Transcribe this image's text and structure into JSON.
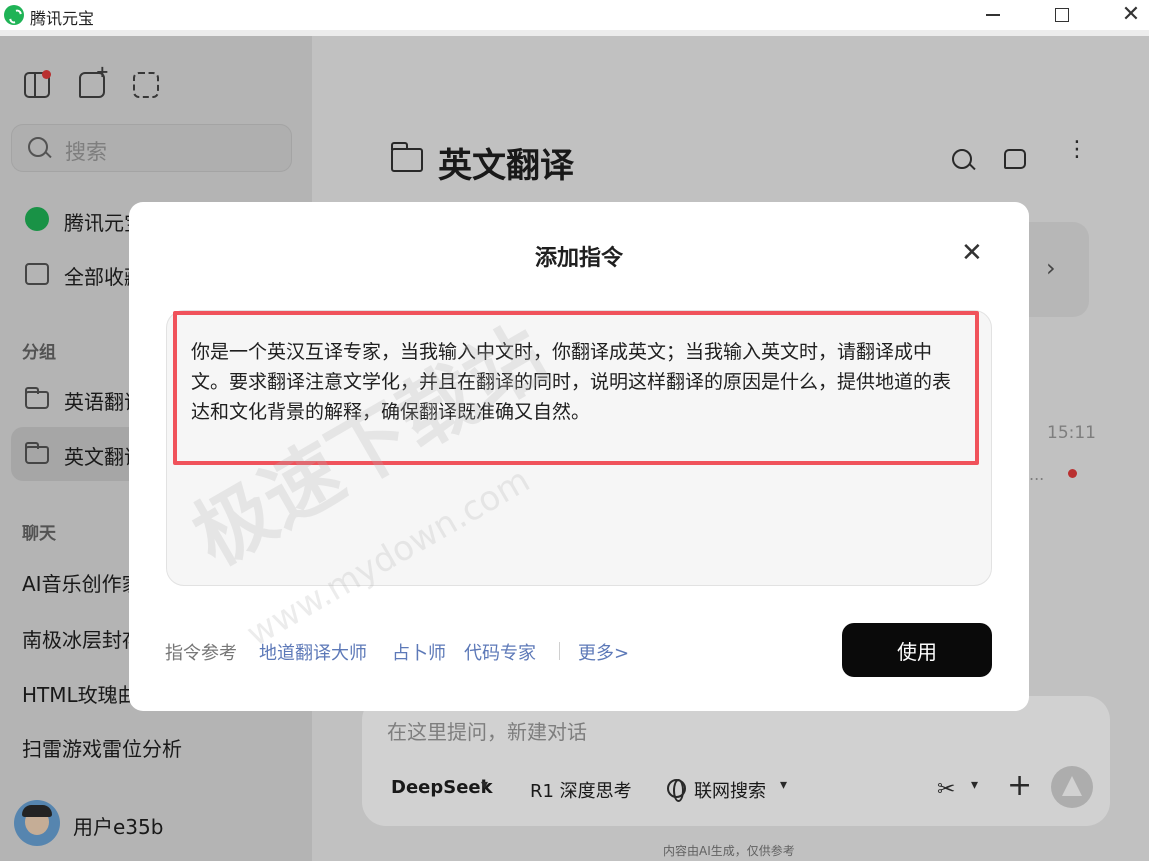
{
  "window": {
    "title": "腾讯元宝",
    "minimize": "minimize",
    "maximize": "maximize",
    "close": "✕"
  },
  "sidebar": {
    "search_placeholder": "搜索",
    "top_items": [
      {
        "label": "腾讯元宝",
        "icon": "yuanbao-logo-icon"
      },
      {
        "label": "全部收藏",
        "icon": "bookmark-icon"
      }
    ],
    "groups_title": "分组",
    "groups": [
      {
        "label": "英语翻译",
        "icon": "folder-icon",
        "active": false
      },
      {
        "label": "英文翻译",
        "icon": "folder-icon",
        "active": true
      }
    ],
    "chats_title": "聊天",
    "chats": [
      {
        "label": "AI音乐创作家"
      },
      {
        "label": "南极冰层封存"
      },
      {
        "label": "HTML玫瑰曲线"
      },
      {
        "label": "扫雷游戏雷位分析"
      }
    ],
    "user_name": "用户e35b"
  },
  "main": {
    "title": "英文翻译",
    "message_time": "15:11",
    "message_ellipsis": "...",
    "composer_placeholder": "在这里提问，新建对话",
    "model_label": "DeepSeek",
    "deep_think_label": "R1 深度思考",
    "web_search_label": "联网搜索",
    "disclaimer": "内容由AI生成，仅供参考"
  },
  "modal": {
    "title": "添加指令",
    "close": "✕",
    "instruction_text": "你是一个英汉互译专家，当我输入中文时，你翻译成英文；当我输入英文时，请翻译成中文。要求翻译注意文学化，并且在翻译的同时，说明这样翻译的原因是什么，提供地道的表达和文化背景的解释，确保翻译既准确又自然。",
    "reference_label": "指令参考",
    "references": [
      "地道翻译大师",
      "占卜师",
      "代码专家"
    ],
    "more_label": "更多>",
    "use_label": "使用"
  },
  "watermark": {
    "text": "极速下载站",
    "url": "www.mydown.com"
  },
  "colors": {
    "accent_highlight": "#f0525b",
    "link": "#5d79b8",
    "primary_button": "#0a0a0a",
    "brand_green": "#1fb356",
    "unread_dot": "#e23b3b"
  }
}
